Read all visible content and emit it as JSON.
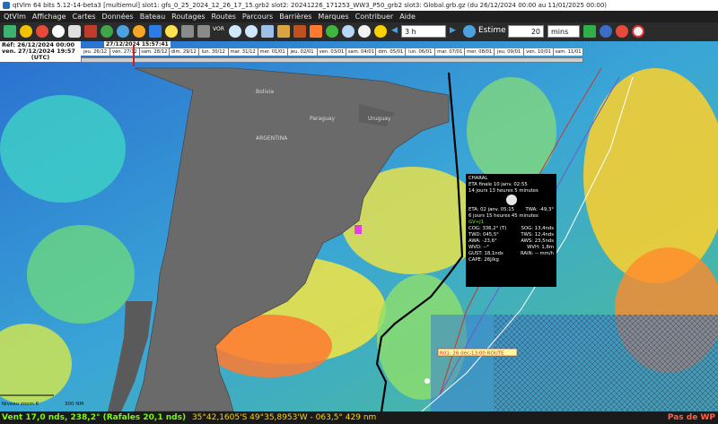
{
  "window": {
    "title": "qtVlm 64 bits 5.12-14-beta3 [multiemul] slot1: gfs_0_25_2024_12_26_17_15.grb2 slot2: 20241226_171253_WW3_P50_grb2 slot3: Global.grb.gz (du 26/12/2024 00:00 au 11/01/2025 00:00)"
  },
  "menu": [
    "QtVlm",
    "Affichage",
    "Cartes",
    "Données",
    "Bateau",
    "Routages",
    "Routes",
    "Parcours",
    "Barrières",
    "Marques",
    "Contribuer",
    "Aide"
  ],
  "toolbar": {
    "step_value": "3 h",
    "estime_label": "Estime",
    "estime_value": "20",
    "estime_unit": "mins",
    "vor_label": "VOR"
  },
  "grib_dates": {
    "current": "27/12/2024 15:57:41",
    "start_line": "Réf: 26/12/2024 00:00",
    "current_line": "ven. 27/12/2024 19:57",
    "tz": "(UTC)"
  },
  "timeline_days": [
    "jeu. 26/12",
    "ven. 27/12",
    "sam. 28/12",
    "dim. 29/12",
    "lun. 30/12",
    "mar. 31/12",
    "mer. 01/01",
    "jeu. 02/01",
    "ven. 03/01",
    "sam. 04/01",
    "dim. 05/01",
    "lun. 06/01",
    "mar. 07/01",
    "mer. 08/01",
    "jeu. 09/01",
    "ven. 10/01",
    "sam. 11/01"
  ],
  "map_labels": {
    "country1": "Bolivia",
    "country2": "Paraguay",
    "country3": "Uruguay",
    "country4": "ARGENTINA",
    "scale_zoom": "Niveau zoom 6",
    "scale_dist": "300 NM",
    "route_tag": "R01: 26 déc-13:00 ROUTE"
  },
  "popup": {
    "name": "CHARAL",
    "eta_line": "ETA finale 10 janv. 02:55",
    "eta_duration": "14 jours 13 heures 5 minutes",
    "eta_point": "ETA: 02 janv. 05:15",
    "twa_label": "TWA: -49,3°",
    "duration2": "6 jours 15 heures 45 minutes",
    "sail": "GV+J1",
    "cog": "COG: 336,2° (T)",
    "sog": "SOG: 13,4nds",
    "twd": "TWD: 045,5°",
    "tws": "TWS: 12,4nds",
    "awa": "AWA: -23,6°",
    "aws": "AWS: 23,5nds",
    "wvd": "WVD: --°",
    "wvh": "WVH: 1,8m",
    "gust": "GUST: 18,1nds",
    "rain": "RAIN: -- mm/h",
    "cape": "CAPE: 26J/kg"
  },
  "status": {
    "wind": "Vent 17,0 nds, 238,2° (Rafales 20,1 nds)",
    "position": "35°42,1605'S 49°35,8953'W - 063,5° 429 nm",
    "right": "Pas de WP"
  },
  "colors": {
    "menubar_bg": "#1f1f1f",
    "status_wind": "#7CFC00",
    "status_pos": "#ffd700",
    "status_right": "#ff6347",
    "land": "#6a6a6a"
  }
}
